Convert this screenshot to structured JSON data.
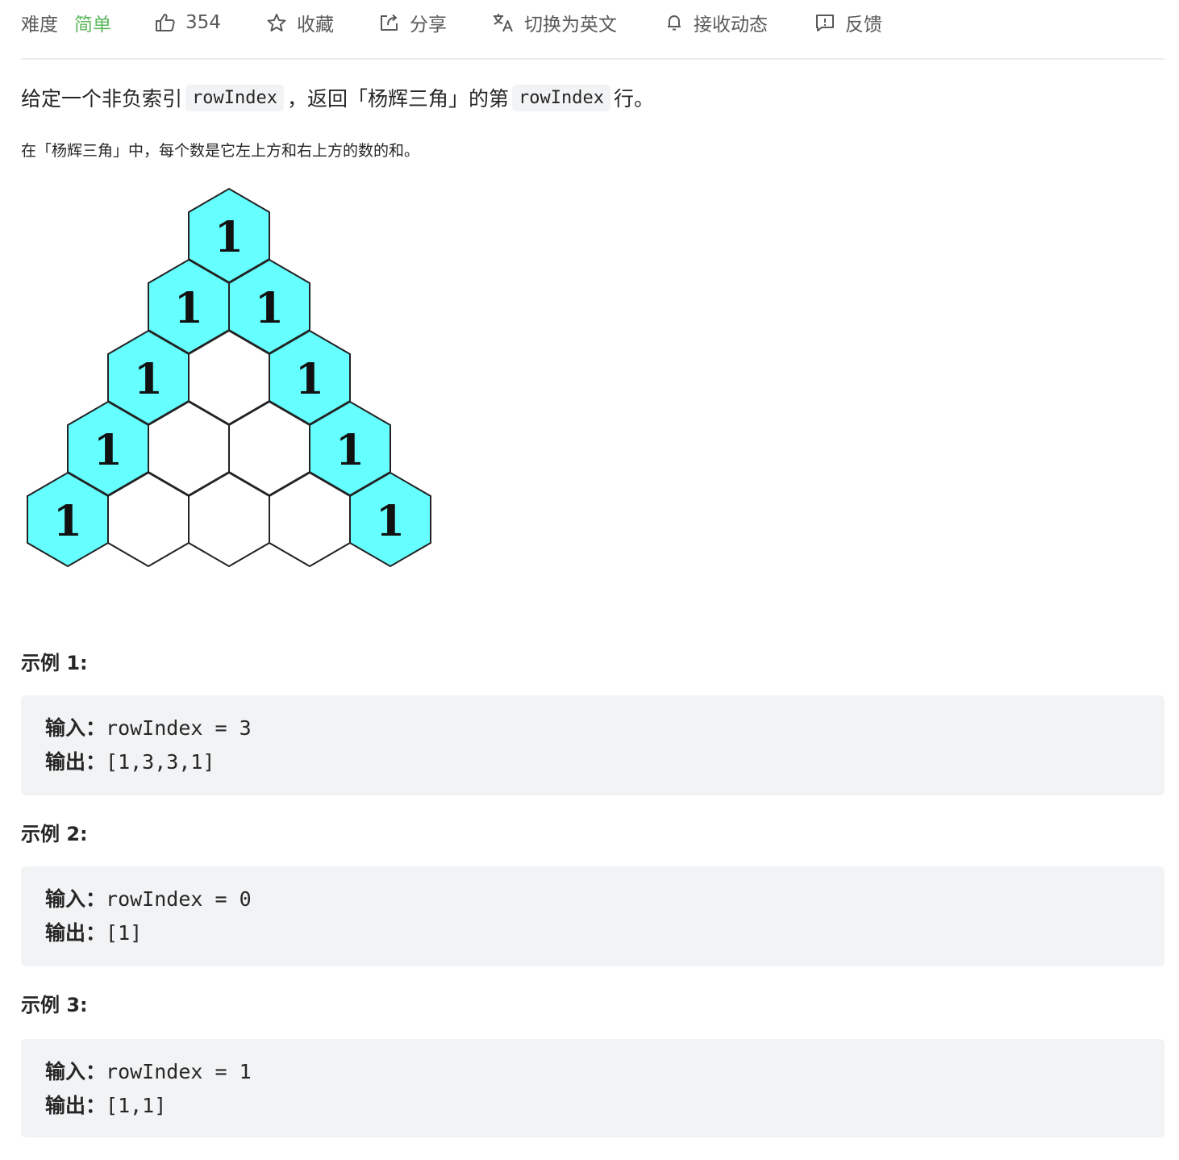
{
  "toolbar": {
    "difficulty_label": "难度",
    "difficulty_value": "简单",
    "likes": "354",
    "favorite_label": "收藏",
    "share_label": "分享",
    "translate_label": "切换为英文",
    "subscribe_label": "接收动态",
    "feedback_label": "反馈"
  },
  "description": {
    "part1": "给定一个非负索引",
    "code1": "rowIndex",
    "part2": "，返回「杨辉三角」的第",
    "code2": "rowIndex",
    "part3": "行。",
    "line2": "在「杨辉三角」中，每个数是它左上方和右上方的数的和。"
  },
  "figure": {
    "rows": [
      [
        "1"
      ],
      [
        "1",
        "1"
      ],
      [
        "1",
        "",
        "1"
      ],
      [
        "1",
        "",
        "",
        "1"
      ],
      [
        "1",
        "",
        "",
        "",
        "1"
      ]
    ],
    "filled_color": "#66ffff",
    "empty_color": "#ffffff"
  },
  "examples": [
    {
      "title": "示例 1:",
      "input_label": "输入：",
      "input_value": "rowIndex = 3",
      "output_label": "输出：",
      "output_value": "[1,3,3,1]"
    },
    {
      "title": "示例 2:",
      "input_label": "输入：",
      "input_value": "rowIndex = 0",
      "output_label": "输出：",
      "output_value": "[1]"
    },
    {
      "title": "示例 3:",
      "input_label": "输入：",
      "input_value": "rowIndex = 1",
      "output_label": "输出：",
      "output_value": "[1,1]"
    }
  ]
}
